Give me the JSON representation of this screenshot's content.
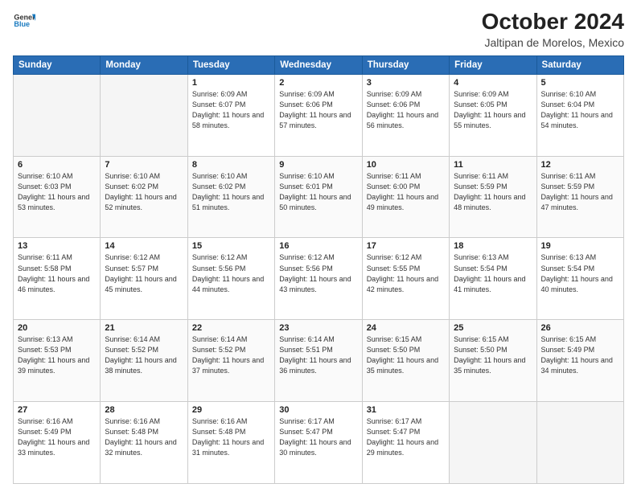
{
  "logo": {
    "general": "General",
    "blue": "Blue"
  },
  "header": {
    "month": "October 2024",
    "location": "Jaltipan de Morelos, Mexico"
  },
  "days_of_week": [
    "Sunday",
    "Monday",
    "Tuesday",
    "Wednesday",
    "Thursday",
    "Friday",
    "Saturday"
  ],
  "weeks": [
    [
      {
        "day": "",
        "info": ""
      },
      {
        "day": "",
        "info": ""
      },
      {
        "day": "1",
        "info": "Sunrise: 6:09 AM\nSunset: 6:07 PM\nDaylight: 11 hours and 58 minutes."
      },
      {
        "day": "2",
        "info": "Sunrise: 6:09 AM\nSunset: 6:06 PM\nDaylight: 11 hours and 57 minutes."
      },
      {
        "day": "3",
        "info": "Sunrise: 6:09 AM\nSunset: 6:06 PM\nDaylight: 11 hours and 56 minutes."
      },
      {
        "day": "4",
        "info": "Sunrise: 6:09 AM\nSunset: 6:05 PM\nDaylight: 11 hours and 55 minutes."
      },
      {
        "day": "5",
        "info": "Sunrise: 6:10 AM\nSunset: 6:04 PM\nDaylight: 11 hours and 54 minutes."
      }
    ],
    [
      {
        "day": "6",
        "info": "Sunrise: 6:10 AM\nSunset: 6:03 PM\nDaylight: 11 hours and 53 minutes."
      },
      {
        "day": "7",
        "info": "Sunrise: 6:10 AM\nSunset: 6:02 PM\nDaylight: 11 hours and 52 minutes."
      },
      {
        "day": "8",
        "info": "Sunrise: 6:10 AM\nSunset: 6:02 PM\nDaylight: 11 hours and 51 minutes."
      },
      {
        "day": "9",
        "info": "Sunrise: 6:10 AM\nSunset: 6:01 PM\nDaylight: 11 hours and 50 minutes."
      },
      {
        "day": "10",
        "info": "Sunrise: 6:11 AM\nSunset: 6:00 PM\nDaylight: 11 hours and 49 minutes."
      },
      {
        "day": "11",
        "info": "Sunrise: 6:11 AM\nSunset: 5:59 PM\nDaylight: 11 hours and 48 minutes."
      },
      {
        "day": "12",
        "info": "Sunrise: 6:11 AM\nSunset: 5:59 PM\nDaylight: 11 hours and 47 minutes."
      }
    ],
    [
      {
        "day": "13",
        "info": "Sunrise: 6:11 AM\nSunset: 5:58 PM\nDaylight: 11 hours and 46 minutes."
      },
      {
        "day": "14",
        "info": "Sunrise: 6:12 AM\nSunset: 5:57 PM\nDaylight: 11 hours and 45 minutes."
      },
      {
        "day": "15",
        "info": "Sunrise: 6:12 AM\nSunset: 5:56 PM\nDaylight: 11 hours and 44 minutes."
      },
      {
        "day": "16",
        "info": "Sunrise: 6:12 AM\nSunset: 5:56 PM\nDaylight: 11 hours and 43 minutes."
      },
      {
        "day": "17",
        "info": "Sunrise: 6:12 AM\nSunset: 5:55 PM\nDaylight: 11 hours and 42 minutes."
      },
      {
        "day": "18",
        "info": "Sunrise: 6:13 AM\nSunset: 5:54 PM\nDaylight: 11 hours and 41 minutes."
      },
      {
        "day": "19",
        "info": "Sunrise: 6:13 AM\nSunset: 5:54 PM\nDaylight: 11 hours and 40 minutes."
      }
    ],
    [
      {
        "day": "20",
        "info": "Sunrise: 6:13 AM\nSunset: 5:53 PM\nDaylight: 11 hours and 39 minutes."
      },
      {
        "day": "21",
        "info": "Sunrise: 6:14 AM\nSunset: 5:52 PM\nDaylight: 11 hours and 38 minutes."
      },
      {
        "day": "22",
        "info": "Sunrise: 6:14 AM\nSunset: 5:52 PM\nDaylight: 11 hours and 37 minutes."
      },
      {
        "day": "23",
        "info": "Sunrise: 6:14 AM\nSunset: 5:51 PM\nDaylight: 11 hours and 36 minutes."
      },
      {
        "day": "24",
        "info": "Sunrise: 6:15 AM\nSunset: 5:50 PM\nDaylight: 11 hours and 35 minutes."
      },
      {
        "day": "25",
        "info": "Sunrise: 6:15 AM\nSunset: 5:50 PM\nDaylight: 11 hours and 35 minutes."
      },
      {
        "day": "26",
        "info": "Sunrise: 6:15 AM\nSunset: 5:49 PM\nDaylight: 11 hours and 34 minutes."
      }
    ],
    [
      {
        "day": "27",
        "info": "Sunrise: 6:16 AM\nSunset: 5:49 PM\nDaylight: 11 hours and 33 minutes."
      },
      {
        "day": "28",
        "info": "Sunrise: 6:16 AM\nSunset: 5:48 PM\nDaylight: 11 hours and 32 minutes."
      },
      {
        "day": "29",
        "info": "Sunrise: 6:16 AM\nSunset: 5:48 PM\nDaylight: 11 hours and 31 minutes."
      },
      {
        "day": "30",
        "info": "Sunrise: 6:17 AM\nSunset: 5:47 PM\nDaylight: 11 hours and 30 minutes."
      },
      {
        "day": "31",
        "info": "Sunrise: 6:17 AM\nSunset: 5:47 PM\nDaylight: 11 hours and 29 minutes."
      },
      {
        "day": "",
        "info": ""
      },
      {
        "day": "",
        "info": ""
      }
    ]
  ]
}
